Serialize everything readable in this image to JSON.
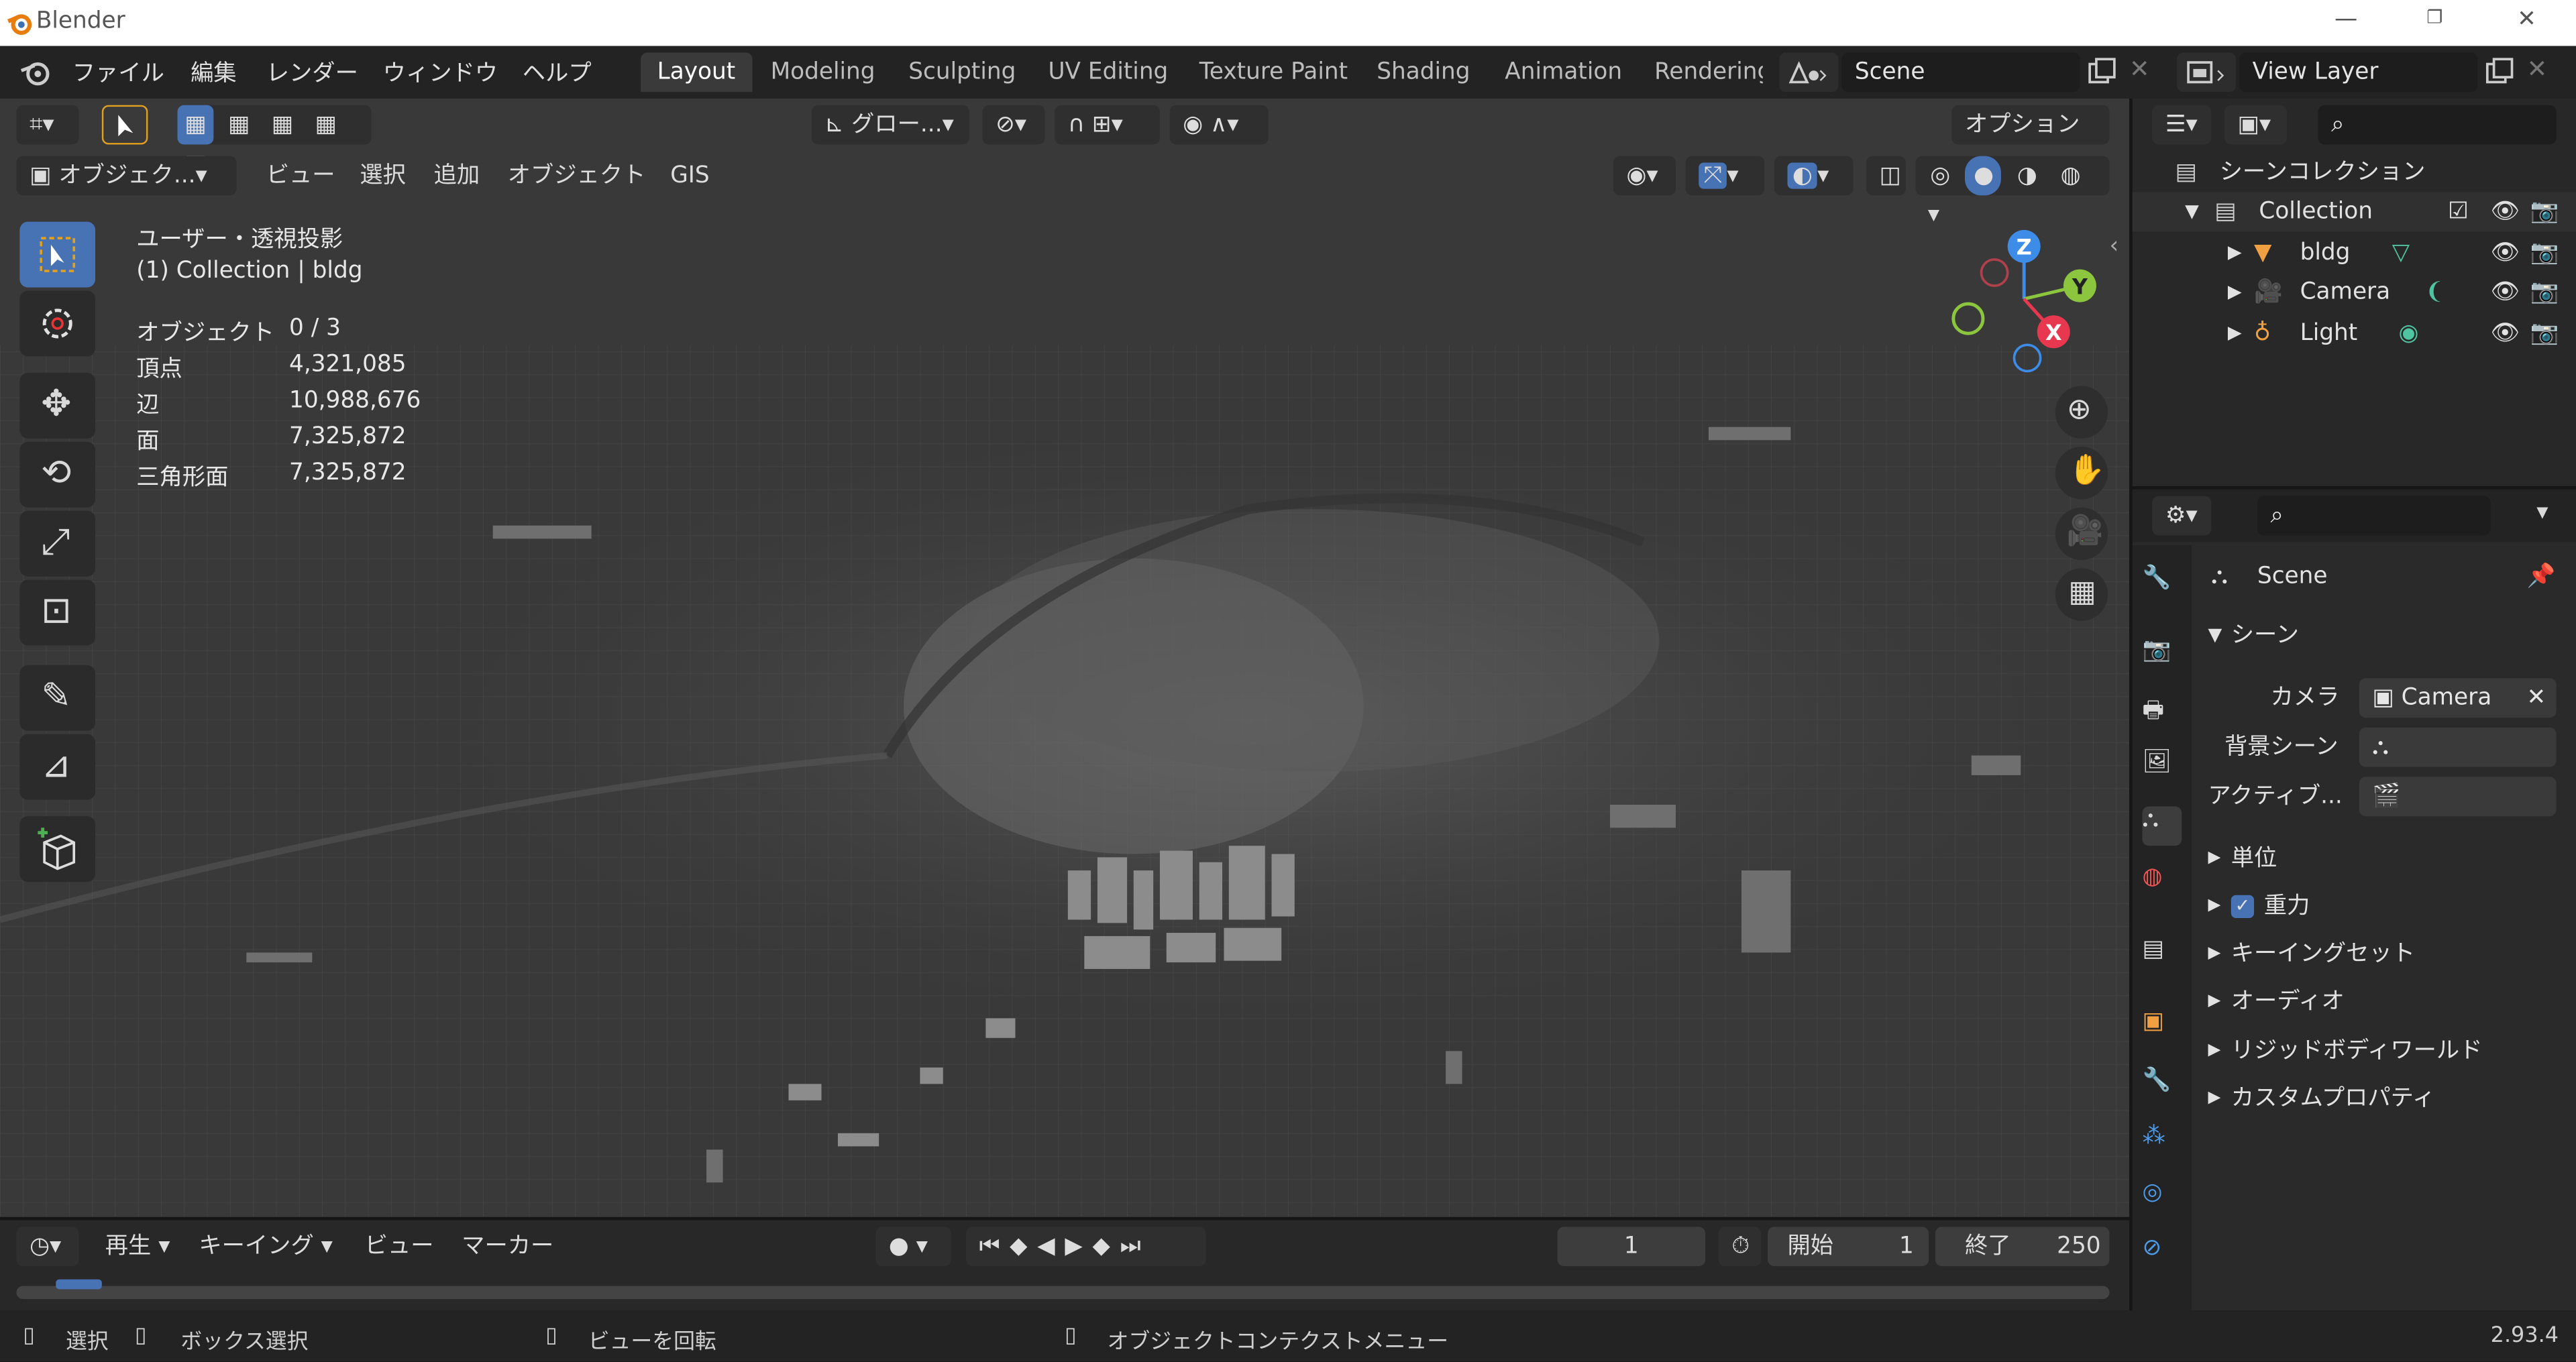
{
  "window": {
    "title": "Blender",
    "min": "—",
    "restore": "❐",
    "close": "✕"
  },
  "menu": [
    "ファイル",
    "編集",
    "レンダー",
    "ウィンドウ",
    "ヘルプ"
  ],
  "workspaces": [
    "Layout",
    "Modeling",
    "Sculpting",
    "UV Editing",
    "Texture Paint",
    "Shading",
    "Animation",
    "Rendering"
  ],
  "scene_field": "Scene",
  "view_layer_field": "View Layer",
  "viewport_header": {
    "transform_orientation": "グロー...",
    "options": "オプション",
    "mode": "オブジェク...",
    "menus": [
      "ビュー",
      "選択",
      "追加",
      "オブジェクト",
      "GIS"
    ]
  },
  "overlay": {
    "view_name": "ユーザー・透視投影",
    "collection": "(1) Collection | bldg",
    "stats": [
      {
        "label": "オブジェクト",
        "value": "0 / 3"
      },
      {
        "label": "頂点",
        "value": "4,321,085"
      },
      {
        "label": "辺",
        "value": "10,988,676"
      },
      {
        "label": "面",
        "value": "7,325,872"
      },
      {
        "label": "三角形面",
        "value": "7,325,872"
      }
    ]
  },
  "gizmo": {
    "z": "Z",
    "y": "Y",
    "x": "X"
  },
  "outliner": {
    "root": "シーンコレクション",
    "collection": "Collection",
    "items": [
      {
        "name": "bldg"
      },
      {
        "name": "Camera"
      },
      {
        "name": "Light"
      }
    ]
  },
  "properties": {
    "scene_name": "Scene",
    "section": "シーン",
    "camera_label": "カメラ",
    "camera_value": "Camera",
    "bg_scene_label": "背景シーン",
    "active_label": "アクティブ...",
    "panels": [
      "単位",
      "重力",
      "キーイングセット",
      "オーディオ",
      "リジッドボディワールド",
      "カスタムプロパティ"
    ]
  },
  "timeline": {
    "menus": [
      "再生",
      "キーイング",
      "ビュー",
      "マーカー"
    ],
    "current_frame": "1",
    "start_label": "開始",
    "start": "1",
    "end_label": "終了",
    "end": "250"
  },
  "status": {
    "select": "選択",
    "box_select": "ボックス選択",
    "rotate": "ビューを回転",
    "context": "オブジェクトコンテクストメニュー",
    "version": "2.93.4"
  },
  "colors": {
    "accent": "#4772b3",
    "axis_x": "#e8384f",
    "axis_y": "#8cc63e",
    "axis_z": "#3d8ce8"
  }
}
